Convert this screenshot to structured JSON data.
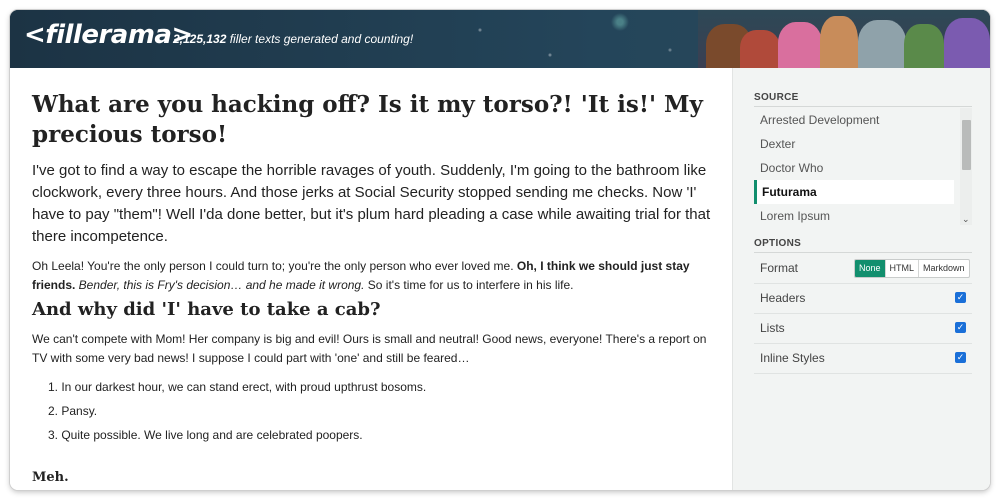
{
  "header": {
    "logo": "<fillerama>",
    "counter_number": "2,125,132",
    "counter_text": " filler texts generated and counting!"
  },
  "main": {
    "heading": "What are you hacking off? Is it my torso?! 'It is!' My precious torso!",
    "lead": "I've got to find a way to escape the horrible ravages of youth. Suddenly, I'm going to the bathroom like clockwork, every three hours. And those jerks at Social Security stopped sending me checks. Now 'I' have to pay \"them\"! Well I'da done better, but it's plum hard pleading a case while awaiting trial for that there incompetence.",
    "para_start": "Oh Leela! You're the only person I could turn to; you're the only person who ever loved me. ",
    "para_bold": "Oh, I think we should just stay friends.",
    "para_italic": " Bender, this is Fry's decision… and he made it wrong.",
    "para_end": " So it's time for us to interfere in his life.",
    "subheading": "And why did 'I' have to take a cab?",
    "para2": "We can't compete with Mom! Her company is big and evil! Ours is small and neutral! Good news, everyone! There's a report on TV with some very bad news! I suppose I could part with 'one' and still be feared…",
    "list": [
      "In our darkest hour, we can stand erect, with proud upthrust bosoms.",
      "Pansy.",
      "Quite possible. We live long and are celebrated poopers."
    ],
    "meh": "Meh."
  },
  "sidebar": {
    "source_title": "SOURCE",
    "sources": [
      "Arrested Development",
      "Dexter",
      "Doctor Who",
      "Futurama",
      "Lorem Ipsum"
    ],
    "active_source": "Futurama",
    "options_title": "OPTIONS",
    "format_label": "Format",
    "format_options": [
      "None",
      "HTML",
      "Markdown"
    ],
    "format_selected": "None",
    "headers_label": "Headers",
    "lists_label": "Lists",
    "inline_styles_label": "Inline Styles",
    "accent_color": "#128f6e",
    "checkbox_color": "#1a6fd8"
  }
}
